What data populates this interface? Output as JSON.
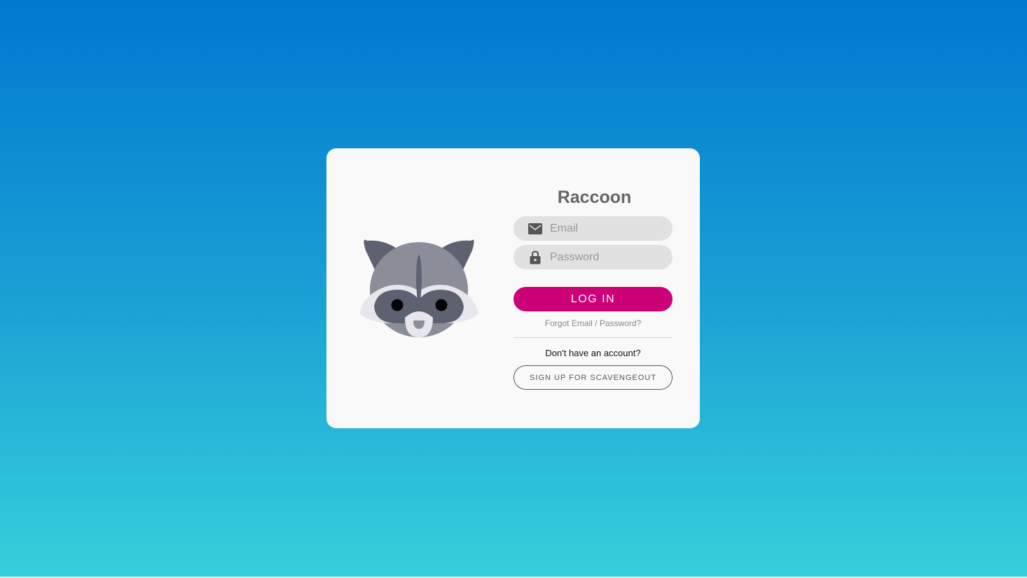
{
  "app": {
    "title": "Raccoon"
  },
  "login": {
    "email_placeholder": "Email",
    "password_placeholder": "Password",
    "login_label": "LOG IN",
    "forgot_label": "Forgot Email / Password?",
    "no_account_label": "Don't have an account?",
    "signup_label": "SIGN UP FOR SCAVENGEOUT"
  },
  "icons": {
    "email": "mail-icon",
    "password": "lock-icon",
    "mascot": "raccoon-logo"
  },
  "colors": {
    "background_top": "#0078d0",
    "background_bottom": "#36d0dc",
    "card": "#f9f9f9",
    "accent": "#cc0077",
    "field": "#e1e1e1",
    "title_text": "#666666"
  }
}
